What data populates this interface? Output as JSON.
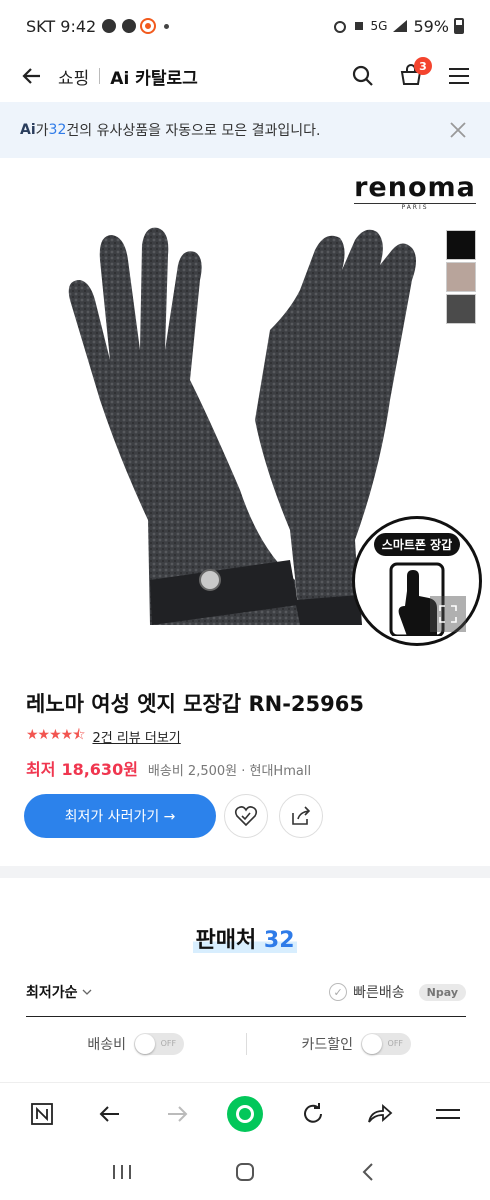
{
  "status_bar": {
    "carrier_time": "SKT 9:42",
    "network": "5G",
    "battery": "59%"
  },
  "header": {
    "shopping": "쇼핑",
    "catalog": "Ai 카탈로그",
    "cart_count": "3"
  },
  "notice": {
    "ai": "Ai",
    "prefix": "가 ",
    "count": "32",
    "suffix": "건의 유사상품을 자동으로 모은 결과입니다."
  },
  "product": {
    "brand": "renoma",
    "brand_sub": "PARIS",
    "smart_badge": "스마트폰 장갑",
    "title": "레노마 여성 엣지 모장갑 RN-25965",
    "rating_stars": 4.5,
    "reviews_link": "2건 리뷰 더보기",
    "price_label": "최저",
    "price": "18,630원",
    "shipping": "배송비 2,500원 · 현대Hmall",
    "buy_button": "최저가 사러가기 →",
    "swatch_colors": [
      "#0d0d0d",
      "#b8a49b",
      "#4b4b4b"
    ]
  },
  "sellers": {
    "heading": "판매처",
    "count": "32",
    "sort": "최저가순",
    "fast_ship": "빠른배송",
    "npay": "Npay",
    "filters": [
      {
        "label": "배송비",
        "toggle": "OFF"
      },
      {
        "label": "카드할인",
        "toggle": "OFF"
      }
    ]
  },
  "icons": {
    "back": "arrow-left-icon",
    "search": "search-icon",
    "cart": "cart-icon",
    "menu": "menu-icon",
    "close": "close-icon",
    "heart": "heart-check-icon",
    "share": "share-icon",
    "naver": "naver-n-icon",
    "forward": "arrow-right-icon",
    "refresh": "refresh-icon",
    "redirect": "redirect-icon"
  }
}
